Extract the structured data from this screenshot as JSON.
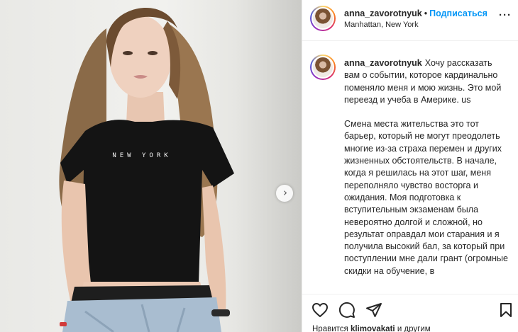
{
  "post": {
    "username": "anna_zavorotnyuk",
    "separator": "•",
    "follow_label": "Подписаться",
    "location": "Manhattan, New York",
    "more_icon": "more-options-icon",
    "shirt_text": "NEW YORK",
    "caption": {
      "username": "anna_zavorotnyuk",
      "paragraph1": "Хочу рассказать вам о событии, которое кардинально поменяло меня и мою жизнь. Это мой переезд и учеба в Америке. us",
      "paragraph2": "Смена места жительства это тот барьер, который не могут преодолеть многие из-за страха перемен и других жизненных обстоятельств. В начале, когда я решилась на этот шаг, меня переполняло чувство восторга и ожидания. Моя подготовка к вступительным экзаменам была невероятно долгой и сложной, но результат оправдал мои старания и я получила высокий бал, за который при поступлении мне дали грант (огромные скидки на обучение, в"
    },
    "likes": {
      "prefix": "Нравится",
      "user": "klimovakati",
      "suffix": "и другим"
    }
  },
  "icons": {
    "next": "chevron-right-icon",
    "like": "heart-icon",
    "comment": "comment-icon",
    "share": "paper-plane-icon",
    "save": "bookmark-icon"
  },
  "colors": {
    "link": "#0095f6",
    "text": "#262626",
    "border": "#efefef"
  }
}
